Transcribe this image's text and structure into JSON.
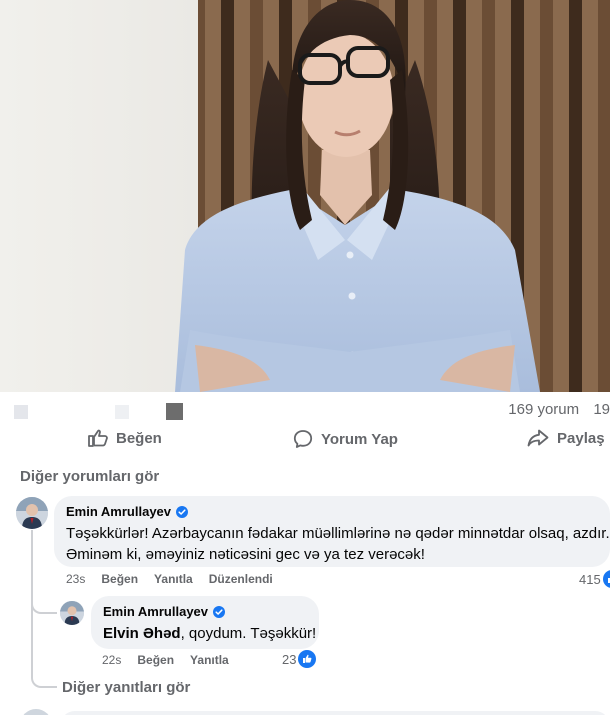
{
  "post": {
    "comment_count": "169 yorum",
    "share_count_partial": "19"
  },
  "actions": {
    "like": "Beğen",
    "comment": "Yorum Yap",
    "share": "Paylaş"
  },
  "more_comments": "Diğer yorumları gör",
  "comment": {
    "author": "Emin Amrullayev",
    "text_line1": "Təşəkkürlər! Azərbaycanın fədakar müəllimlərinə nə qədər minnətdar olsaq, azdır.",
    "text_line2": "Əminəm ki, əməyiniz nəticəsini gec və ya tez verəcək!",
    "time": "23s",
    "like": "Beğen",
    "reply": "Yanıtla",
    "edited": "Düzenlendi",
    "reactions": "415"
  },
  "reply": {
    "author": "Emin Amrullayev",
    "mention": "Elvin Əhəd",
    "text": ", qoydum. Təşəkkür!",
    "time": "22s",
    "like": "Beğen",
    "reply": "Yanıtla",
    "reactions": "23"
  },
  "more_replies": "Diğer yanıtları gör",
  "colors": {
    "accent": "#1877f2",
    "secondary_text": "#65676b",
    "bubble": "#f0f2f5"
  }
}
